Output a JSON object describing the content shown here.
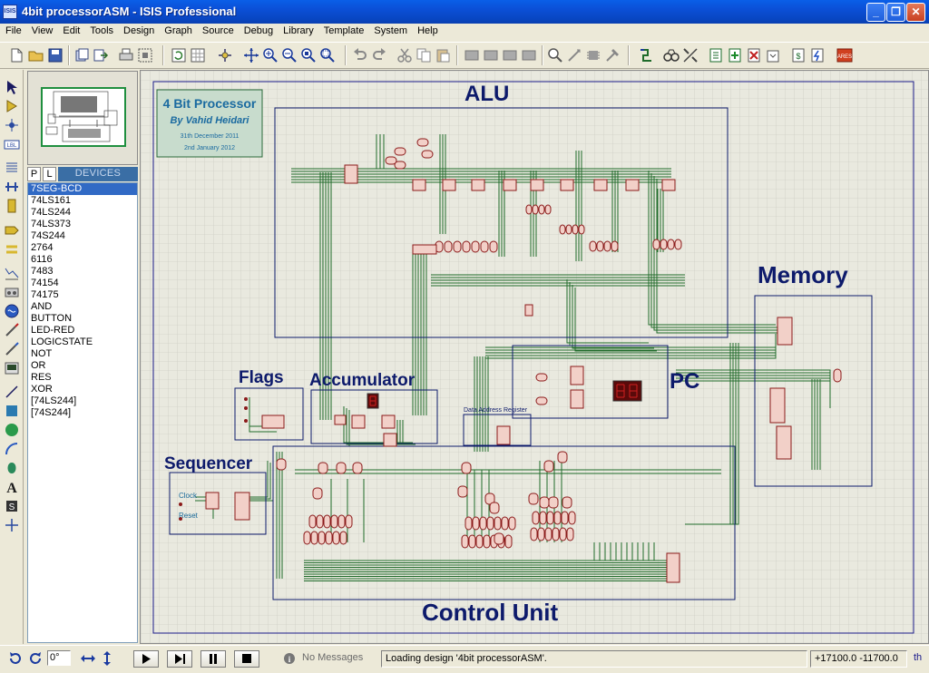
{
  "window": {
    "app_icon_text": "ISIS",
    "title": "4bit processorASM - ISIS Professional",
    "minimize": "_",
    "restore": "❐",
    "close": "✕"
  },
  "menu": [
    "File",
    "View",
    "Edit",
    "Tools",
    "Design",
    "Graph",
    "Source",
    "Debug",
    "Library",
    "Template",
    "System",
    "Help"
  ],
  "devices_panel": {
    "tab_p": "P",
    "tab_l": "L",
    "label": "DEVICES",
    "items": [
      "7SEG-BCD",
      "74LS161",
      "74LS244",
      "74LS373",
      "74S244",
      "2764",
      "6116",
      "7483",
      "74154",
      "74175",
      "AND",
      "BUTTON",
      "LED-RED",
      "LOGICSTATE",
      "NOT",
      "OR",
      "RES",
      "XOR",
      "[74LS244]",
      "[74S244]"
    ],
    "selected_index": 0
  },
  "schematic": {
    "info_box": {
      "title": "4 Bit Processor",
      "author": "By Vahid Heidari",
      "date1": "31th December 2011",
      "date2": "2nd January 2012"
    },
    "block_labels": {
      "alu": "ALU",
      "memory": "Memory",
      "flags": "Flags",
      "accumulator": "Accumulator",
      "pc": "PC",
      "sequencer": "Sequencer",
      "control_unit": "Control Unit",
      "data_address_register": "Data Address Register",
      "clock": "Clock",
      "reset": "Reset"
    },
    "colors": {
      "wire": "#1f6b2a",
      "component": "#8b1a1a",
      "component_fill": "#f2d0c8",
      "label": "#0d1a6b",
      "block": "#0d1a6b",
      "grid": "#c8c8c0"
    }
  },
  "status": {
    "rotation": "0°",
    "messages": "No Messages",
    "status_text": "Loading design '4bit processorASM'.",
    "coords": "+17100.0  -11700.0",
    "units": "th"
  }
}
